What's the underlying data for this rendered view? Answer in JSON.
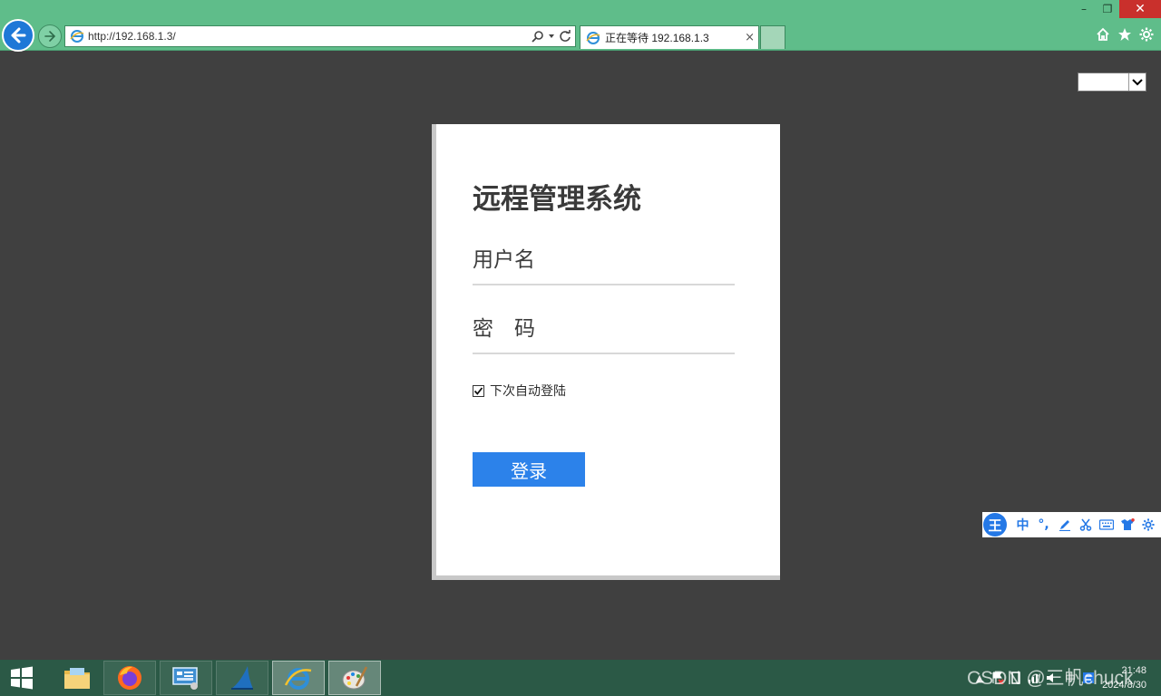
{
  "browser": {
    "address": "http://192.168.1.3/",
    "tab_title": "正在等待 192.168.1.3",
    "tab_close": "×",
    "win_minimize": "–",
    "win_restore": "❐",
    "win_close": "✕"
  },
  "page": {
    "language_select_value": "",
    "title": "远程管理系统",
    "username_placeholder": "用户名",
    "password_placeholder": "密　码",
    "remember_label": "下次自动登陆",
    "remember_checked": true,
    "login_button": "登录"
  },
  "ime": {
    "logo": "王",
    "mode": "中",
    "punct": "°,"
  },
  "taskbar": {
    "apps": [
      "file-explorer",
      "firefox",
      "server-manager",
      "wireshark",
      "internet-explorer",
      "paint"
    ],
    "active_app": "internet-explorer",
    "tray_lang": "中",
    "time": "21:48",
    "date": "2024/8/30",
    "watermark": "CSDN @三帆chuck"
  },
  "colors": {
    "chrome": "#5fbd8a",
    "page_bg": "#404040",
    "login_button": "#2c82ea",
    "taskbar": "#2b5946"
  }
}
